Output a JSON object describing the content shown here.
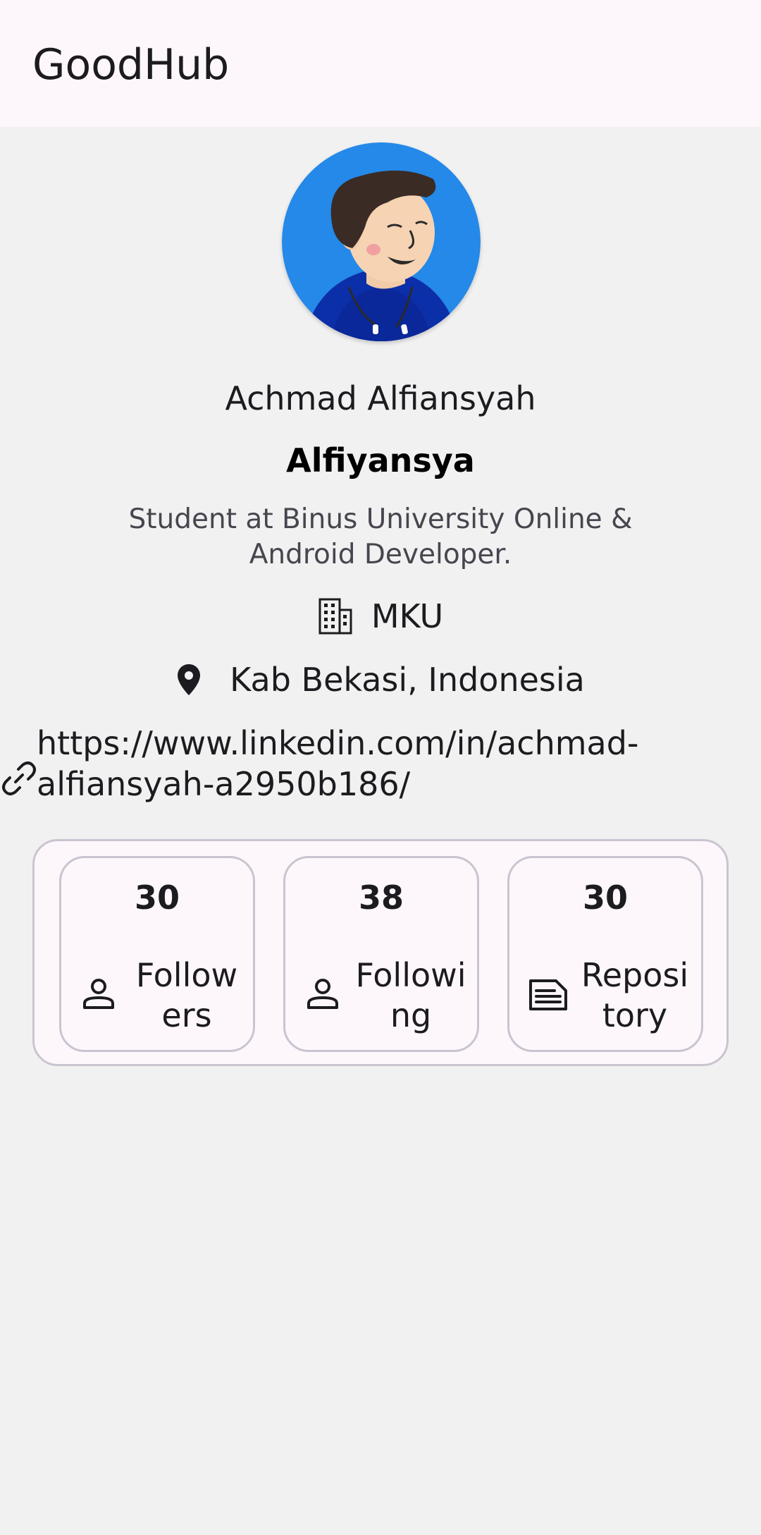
{
  "app_bar": {
    "title": "GoodHub"
  },
  "profile": {
    "avatar_icon": "cartoon-avatar",
    "full_name": "Achmad Alfiansyah",
    "username": "Alfiyansya",
    "bio": "Student at Binus University Online & Android Developer.",
    "company": "MKU",
    "company_icon": "building-icon",
    "location": "Kab Bekasi, Indonesia",
    "location_icon": "location-pin-icon",
    "blog": "https://www.linkedin.com/in/achmad-alfiansyah-a2950b186/",
    "blog_icon": "link-icon"
  },
  "stats": {
    "followers": {
      "value": "30",
      "label": "Followers",
      "icon": "person-icon"
    },
    "following": {
      "value": "38",
      "label": "Following",
      "icon": "person-icon"
    },
    "repository": {
      "value": "30",
      "label": "Repository",
      "icon": "article-icon"
    }
  },
  "colors": {
    "app_bar_bg": "#fdf7fc",
    "page_bg": "#f1f1f1",
    "avatar_bg": "#2489e8",
    "outline": "#cac4d0"
  }
}
